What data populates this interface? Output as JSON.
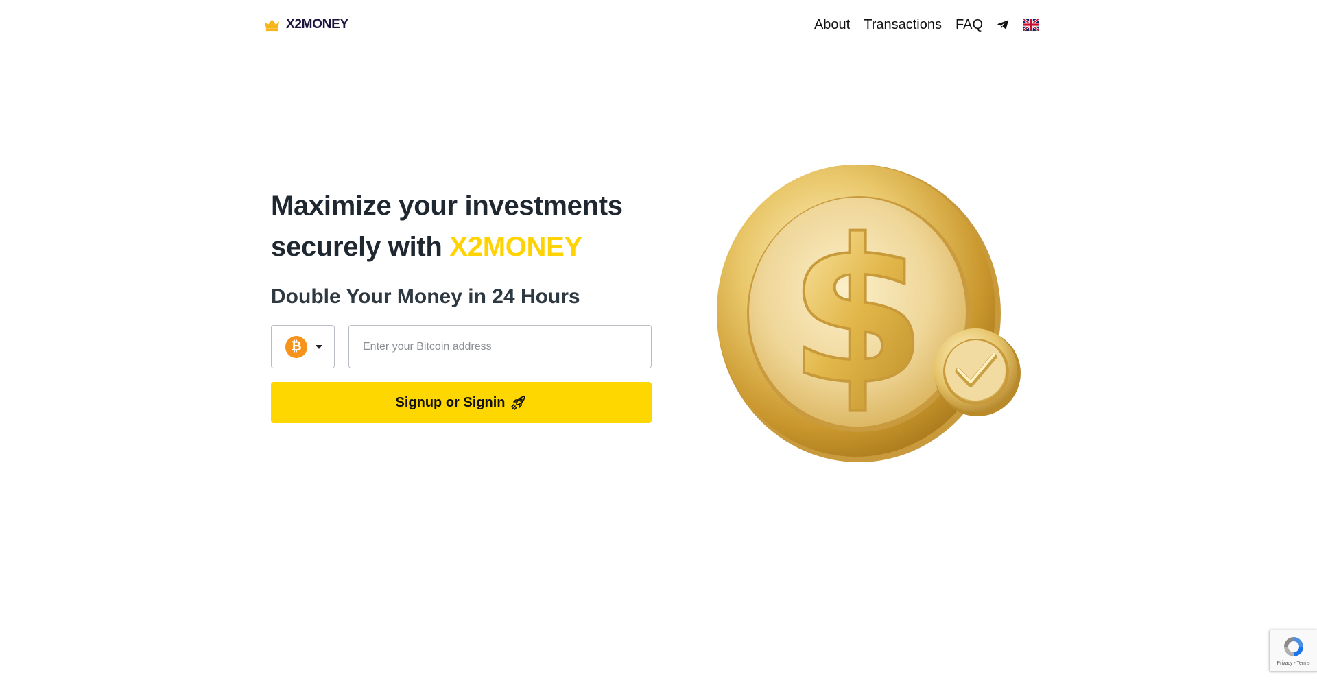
{
  "header": {
    "brand_name": "X2MONEY",
    "nav": {
      "about": "About",
      "transactions": "Transactions",
      "faq": "FAQ"
    },
    "icons": {
      "crown": "crown-icon",
      "telegram": "telegram-icon",
      "language": "uk-flag-icon"
    }
  },
  "hero": {
    "headline_part1": "Maximize your investments",
    "headline_part2": "securely with",
    "headline_brand": "X2MONEY",
    "subheadline": "Double Your Money in 24 Hours",
    "currency": {
      "selected_symbol": "₿",
      "icon": "bitcoin-icon"
    },
    "address_input": {
      "placeholder": "Enter your Bitcoin address",
      "value": ""
    },
    "cta_label": "Signup or Signin",
    "cta_icon": "rocket-icon",
    "illustration": "gold-dollar-coin-with-checkmark"
  },
  "recaptcha": {
    "legal": "Privacy - Terms"
  },
  "colors": {
    "accent": "#ffd302",
    "button": "#ffd700",
    "bitcoin": "#f7931a",
    "text_dark": "#1f2730"
  }
}
